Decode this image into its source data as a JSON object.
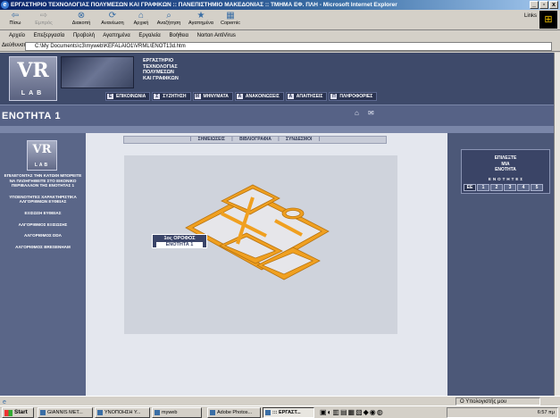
{
  "window": {
    "title": "ΕΡΓΑΣΤΗΡΙΟ ΤΕΧΝΟΛΟΓΙΑΣ ΠΟΛΥΜΕΣΩΝ ΚΑΙ ΓΡΑΦΙΚΩΝ  ::  ΠΑΝΕΠΙΣΤΗΜΙΟ ΜΑΚΕΔΟΝΙΑΣ  ::  ΤΜΗΜΑ ΕΦ. ΠΛΗ - Microsoft Internet Explorer"
  },
  "toolbar": {
    "back": "Πίσω",
    "forward": "Εμπρός",
    "stop": "Διακοπή",
    "refresh": "Ανανέωση",
    "home": "Αρχική",
    "search": "Αναζήτηση",
    "favorites": "Αγαπημένα",
    "copernic": "Copernic",
    "links": "Links"
  },
  "menubar": {
    "items": [
      "Αρχείο",
      "Επεξεργασία",
      "Προβολή",
      "Αγαπημένα",
      "Εργαλεία",
      "Βοήθεια",
      "Norton AntiVirus"
    ]
  },
  "address": {
    "label": "Διεύθυνση",
    "value": "C:\\My Documents\\c3\\myweb\\KEFALAIO1\\VRML\\ENOT13d.htm"
  },
  "site": {
    "logo_main": "VR",
    "logo_sub": "LAB",
    "lab_lines": [
      "ΕΡΓΑΣΤΗΡΙΟ",
      "ΤΕΧΝΟΛΟΓΙΑΣ",
      "ΠΟΛΥΜΕΣΩΝ",
      "ΚΑΙ ΓΡΑΦΙΚΩΝ"
    ],
    "nav": [
      "ΕΠΙΚΟΙΝΩΝΙΑ",
      "ΣΥΖΗΤΗΣΗ",
      "ΜΗΝΥΜΑΤΑ",
      "ΑΝΑΚΟΙΝΩΣΕΙΣ",
      "ΑΠΑΙΤΗΣΕΙΣ",
      "ΠΛΗΡΟΦΟΡΙΕΣ"
    ],
    "nav_icons": [
      "E",
      "Σ",
      "M",
      "A",
      "A",
      "Π"
    ],
    "section_title": "ΕΝΟΤΗΤΑ 1",
    "home_icon": "⌂",
    "mail_icon": "✉"
  },
  "left": {
    "menu": [
      "ΕΠΙΛΕΓΟΝΤΑΣ ΤΗΝ ΚΑΤΩΘΙ ΜΠΟΡΕΙΤΕ ΝΑ ΠΛΟΗΓΗΘΕΙΤΕ ΣΤΟ ΕΙΚΟΝΙΚΟ ΠΕΡΙΒΑΛΛΟΝ ΤΗΣ ΕΝΟΤΗΤΑΣ 1",
      "ΥΠΟΕΝΟΤΗΤΕΣ ΧΑΡΑΚΤΗΡΙΣΤΙΚΑ ΑΛΓΟΡΙΘΜΩΝ ΕΥΘΕΙΑΣ",
      "ΕΞΙΣΩΣΗ ΕΥΘΕΙΑΣ",
      "ΑΛΓΟΡΙΘΜΟΣ ΕΞΙΣΩΣΗΣ",
      "ΑΛΓΟΡΙΘΜΟΣ DDA",
      "ΑΛΓΟΡΙΘΜΟΣ BRESENHAM"
    ]
  },
  "center": {
    "subnav": [
      "ΣΗΜΕΙΩΣΕΙΣ",
      "ΒΙΒΛΙΟΓΡΑΦΙΑ",
      "ΣΥΝΔΕΣΜΟΙ"
    ],
    "floor_label": "1ος ΟΡΟΦΟΣ",
    "floor_selected": "ΕΝΟΤΗΤΑ 1"
  },
  "right": {
    "choose_lines": [
      "ΕΠΙΛΕΞΤΕ",
      "ΜΙΑ",
      "ΕΝΟΤΗΤΑ"
    ],
    "units_label": "ΕΝΟΤΗΤΕΣ",
    "units": [
      "ΕΕ",
      "1",
      "2",
      "3",
      "4",
      "5"
    ]
  },
  "status": {
    "zone": "Ο Υπολογιστής μου"
  },
  "taskbar": {
    "start": "Start",
    "tasks": [
      "GIANNIS MET...",
      "ΥΝΟΠΟΗΣΗ Υ...",
      "myweb",
      "Adobe Photos...",
      "::: ΕΡΓΑΣΤ..."
    ],
    "clock": "6:57 πμ"
  },
  "colors": {
    "header": "#3e4a6a",
    "model_orange": "#f0a020",
    "accent": "#566286"
  }
}
